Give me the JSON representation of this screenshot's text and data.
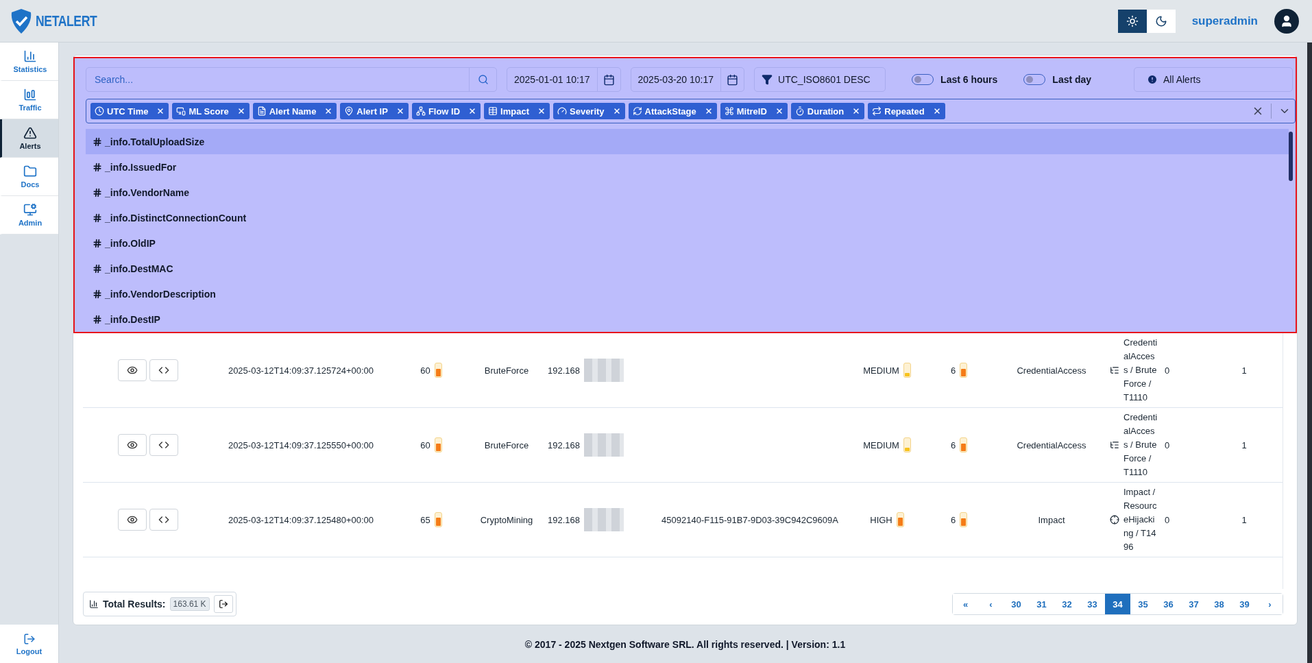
{
  "header": {
    "logo_text": "NETALERT",
    "theme": [
      {
        "kind": "light",
        "selected": true
      },
      {
        "kind": "dark",
        "selected": false
      }
    ],
    "user": "superadmin"
  },
  "sidebar": {
    "items": [
      {
        "label": "Statistics",
        "kind": "chart",
        "selected": false
      },
      {
        "label": "Traffic",
        "kind": "traffic",
        "selected": false
      },
      {
        "label": "Alerts",
        "kind": "alert",
        "selected": true
      },
      {
        "label": "Docs",
        "kind": "folder",
        "selected": false
      },
      {
        "label": "Admin",
        "kind": "admin",
        "selected": false
      }
    ],
    "logout": "Logout"
  },
  "toolbar": {
    "search": {
      "placeholder": "Search..."
    },
    "date_from": "2025-01-01 10:17",
    "date_to": "2025-03-20 10:17",
    "sort": "UTC_ISO8601 DESC",
    "toggles": [
      {
        "label": "Last 6 hours",
        "on": false
      },
      {
        "label": "Last day",
        "on": false
      }
    ],
    "filter": "All Alerts"
  },
  "columns_select": {
    "chips": [
      {
        "label": "UTC Time",
        "kind": "clock"
      },
      {
        "label": "ML Score",
        "kind": "devices"
      },
      {
        "label": "Alert Name",
        "kind": "doc"
      },
      {
        "label": "Alert IP",
        "kind": "pin"
      },
      {
        "label": "Flow ID",
        "kind": "network"
      },
      {
        "label": "Impact",
        "kind": "table"
      },
      {
        "label": "Severity",
        "kind": "gauge"
      },
      {
        "label": "AttackStage",
        "kind": "cycle"
      },
      {
        "label": "MitreID",
        "kind": "command"
      },
      {
        "label": "Duration",
        "kind": "timer"
      },
      {
        "label": "Repeated",
        "kind": "repeat"
      }
    ],
    "options": [
      {
        "label": "_info.TotalUploadSize",
        "selected": true
      },
      {
        "label": "_info.IssuedFor",
        "selected": false
      },
      {
        "label": "_info.VendorName",
        "selected": false
      },
      {
        "label": "_info.DistinctConnectionCount",
        "selected": false
      },
      {
        "label": "_info.OldIP",
        "selected": false
      },
      {
        "label": "_info.DestMAC",
        "selected": false
      },
      {
        "label": "_info.VendorDescription",
        "selected": false
      },
      {
        "label": "_info.DestIP",
        "selected": false
      }
    ]
  },
  "table": {
    "rows": [
      {
        "utc_time": "2025-03-12T14:09:37.125724+00:00",
        "ml_score": {
          "text": "60",
          "level": 0.6
        },
        "alert_name": "BruteForce",
        "alert_ip": "192.168",
        "flow_id": "",
        "severity": {
          "text": "MEDIUM",
          "level": 0.3,
          "color": "#f7c21c"
        },
        "impact": {
          "text": "6",
          "level": 0.6
        },
        "attack_stage": "CredentialAccess",
        "mitre_id": {
          "kind": "list",
          "text": "CredentialAccess / BruteForce / T1110"
        },
        "duration": "0",
        "repeated": "1"
      },
      {
        "utc_time": "2025-03-12T14:09:37.125550+00:00",
        "ml_score": {
          "text": "60",
          "level": 0.6
        },
        "alert_name": "BruteForce",
        "alert_ip": "192.168",
        "flow_id": "",
        "severity": {
          "text": "MEDIUM",
          "level": 0.3,
          "color": "#f7c21c"
        },
        "impact": {
          "text": "6",
          "level": 0.6
        },
        "attack_stage": "CredentialAccess",
        "mitre_id": {
          "kind": "list",
          "text": "CredentialAccess / BruteForce / T1110"
        },
        "duration": "0",
        "repeated": "1"
      },
      {
        "utc_time": "2025-03-12T14:09:37.125480+00:00",
        "ml_score": {
          "text": "65",
          "level": 0.65
        },
        "alert_name": "CryptoMining",
        "alert_ip": "192.168",
        "flow_id": "45092140-F115-91B7-9D03-39C942C9609A",
        "severity": {
          "text": "HIGH",
          "level": 0.65,
          "color": "#f57c17"
        },
        "impact": {
          "text": "6",
          "level": 0.6
        },
        "attack_stage": "Impact",
        "mitre_id": {
          "kind": "target",
          "text": "Impact / ResourceHijacking / T1496"
        },
        "duration": "0",
        "repeated": "1"
      }
    ]
  },
  "results": {
    "label": "Total Results:",
    "count": "163.61 K"
  },
  "pagination": [
    {
      "label": "«",
      "selected": false
    },
    {
      "label": "‹",
      "selected": false
    },
    {
      "label": "30",
      "selected": false
    },
    {
      "label": "31",
      "selected": false
    },
    {
      "label": "32",
      "selected": false
    },
    {
      "label": "33",
      "selected": false
    },
    {
      "label": "34",
      "selected": true
    },
    {
      "label": "35",
      "selected": false
    },
    {
      "label": "36",
      "selected": false
    },
    {
      "label": "37",
      "selected": false
    },
    {
      "label": "38",
      "selected": false
    },
    {
      "label": "39",
      "selected": false
    },
    {
      "label": "›",
      "selected": false
    }
  ],
  "footer": "© 2017 - 2025 Nextgen Software SRL. All rights reserved. | Version: 1.1"
}
